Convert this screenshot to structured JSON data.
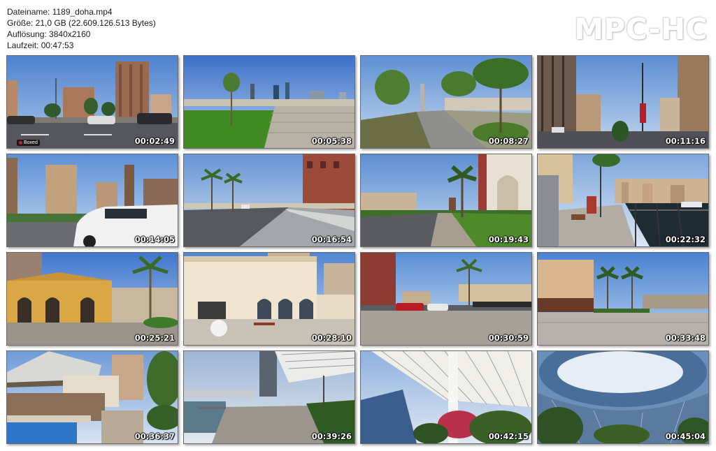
{
  "info": {
    "filename": "Dateiname: 1189_doha.mp4",
    "size": "Größe: 21,0 GB (22.609.126.513 Bytes)",
    "resolution": "Auflösung: 3840x2160",
    "duration": "Laufzeit: 00:47:53"
  },
  "logo": "MPC-HC",
  "watermark": "Boxed",
  "thumbnails": [
    {
      "time": "00:02:49",
      "scene": "street-towers"
    },
    {
      "time": "00:05:38",
      "scene": "promenade-lawn"
    },
    {
      "time": "00:08:27",
      "scene": "tree-path"
    },
    {
      "time": "00:11:16",
      "scene": "road-towers"
    },
    {
      "time": "00:14:05",
      "scene": "street-car"
    },
    {
      "time": "00:16:54",
      "scene": "palm-road"
    },
    {
      "time": "00:19:43",
      "scene": "plaza-arch"
    },
    {
      "time": "00:22:32",
      "scene": "marina-walk"
    },
    {
      "time": "00:25:21",
      "scene": "yellow-building"
    },
    {
      "time": "00:28:10",
      "scene": "white-arcade"
    },
    {
      "time": "00:30:59",
      "scene": "street-cars"
    },
    {
      "time": "00:33:48",
      "scene": "square-palms"
    },
    {
      "time": "00:36:37",
      "scene": "pool-canopy"
    },
    {
      "time": "00:39:26",
      "scene": "seaside-walk"
    },
    {
      "time": "00:42:15",
      "scene": "pergola-sky"
    },
    {
      "time": "00:45:04",
      "scene": "ring-building"
    }
  ],
  "colors": {
    "sky": "#6f9fd8",
    "asphalt": "#5a5d63",
    "grass": "#4f8f2f",
    "sand": "#d8c49a"
  }
}
